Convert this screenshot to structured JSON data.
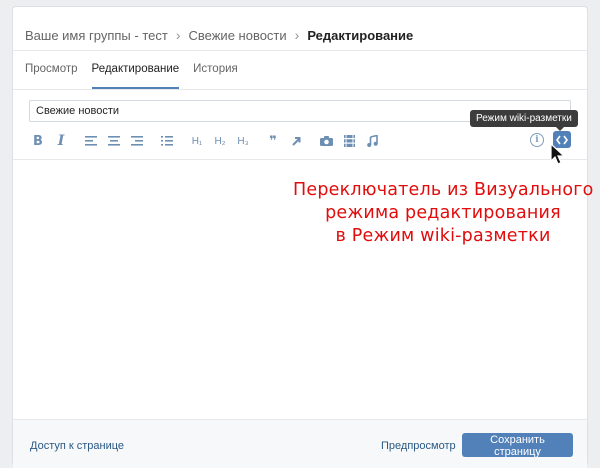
{
  "breadcrumbs": {
    "group": "Ваше имя группы - тест",
    "section": "Свежие новости",
    "current": "Редактирование"
  },
  "tabs": [
    {
      "label": "Просмотр",
      "active": false
    },
    {
      "label": "Редактирование",
      "active": true
    },
    {
      "label": "История",
      "active": false
    }
  ],
  "editor": {
    "title_value": "Свежие новости",
    "toolbar": {
      "bold_label": "B",
      "italic_label": "I",
      "h1_label": "H₁",
      "h2_label": "H₂",
      "h3_label": "H₃",
      "quote_label": "❞",
      "info_label": "i"
    },
    "wiki_tooltip": "Режим wiki-разметки"
  },
  "annotation": {
    "line1": "Переключатель из Визуального",
    "line2": "режима редактирования",
    "line3": "в Режим wiki-разметки",
    "color": "#e10c0c"
  },
  "footer": {
    "access_link": "Доступ к странице",
    "preview_link": "Предпросмотр",
    "save_label": "Сохранить страницу"
  },
  "colors": {
    "accent": "#5181b8",
    "link": "#2a5885",
    "icon": "#6d8fb3"
  }
}
